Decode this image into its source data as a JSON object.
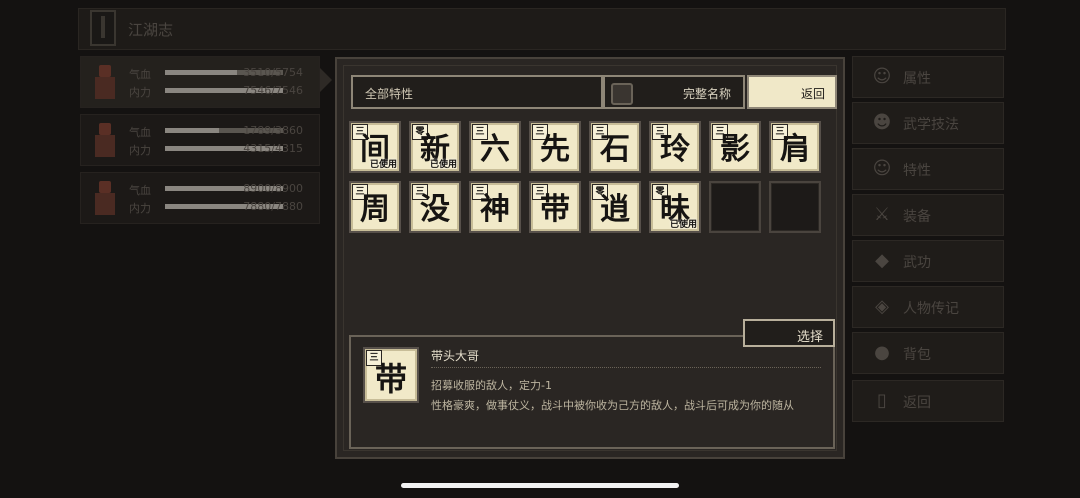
{
  "header": {
    "title": "江湖志"
  },
  "party": [
    {
      "hp_label": "气血",
      "hp": "3510/5754",
      "hp_frac": 0.61,
      "mp_label": "内力",
      "mp": "7546/7546",
      "mp_frac": 1.0
    },
    {
      "hp_label": "气血",
      "hp": "1789/3860",
      "hp_frac": 0.46,
      "mp_label": "内力",
      "mp": "4315/4315",
      "mp_frac": 1.0
    },
    {
      "hp_label": "气血",
      "hp": "8900/8900",
      "hp_frac": 1.0,
      "mp_label": "内力",
      "mp": "7880/7880",
      "mp_frac": 1.0
    }
  ],
  "side_menu": [
    {
      "label": "属性",
      "icon": "character-icon"
    },
    {
      "label": "武学技法",
      "icon": "martial-icon"
    },
    {
      "label": "特性",
      "icon": "trait-icon"
    },
    {
      "label": "装备",
      "icon": "sword-icon"
    },
    {
      "label": "武功",
      "icon": "scroll-icon"
    },
    {
      "label": "人物传记",
      "icon": "book-icon"
    },
    {
      "label": "背包",
      "icon": "bag-icon"
    },
    {
      "label": "返回",
      "icon": "door-icon"
    }
  ],
  "modal": {
    "filter_label": "全部特性",
    "fullname_label": "完整名称",
    "return_label": "返回",
    "select_label": "选择",
    "tiles": [
      {
        "glyph": "间",
        "grade": "三",
        "used": "已使用"
      },
      {
        "glyph": "新",
        "grade": "零",
        "used": "已使用"
      },
      {
        "glyph": "六",
        "grade": "三",
        "used": ""
      },
      {
        "glyph": "先",
        "grade": "三",
        "used": ""
      },
      {
        "glyph": "石",
        "grade": "三",
        "used": ""
      },
      {
        "glyph": "玲",
        "grade": "三",
        "used": ""
      },
      {
        "glyph": "影",
        "grade": "三",
        "used": ""
      },
      {
        "glyph": "肩",
        "grade": "三",
        "used": ""
      },
      {
        "glyph": "周",
        "grade": "三",
        "used": ""
      },
      {
        "glyph": "没",
        "grade": "三",
        "used": ""
      },
      {
        "glyph": "神",
        "grade": "三",
        "used": ""
      },
      {
        "glyph": "带",
        "grade": "三",
        "used": ""
      },
      {
        "glyph": "逍",
        "grade": "零",
        "used": ""
      },
      {
        "glyph": "昧",
        "grade": "零",
        "used": "已使用"
      }
    ],
    "empty_slots": 2,
    "detail": {
      "glyph": "带",
      "grade": "三",
      "name": "带头大哥",
      "effect": "招募收服的敌人，定力-1",
      "description": "性格豪爽，做事仗义，战斗中被你收为己方的敌人，战斗后可成为你的随从"
    }
  }
}
